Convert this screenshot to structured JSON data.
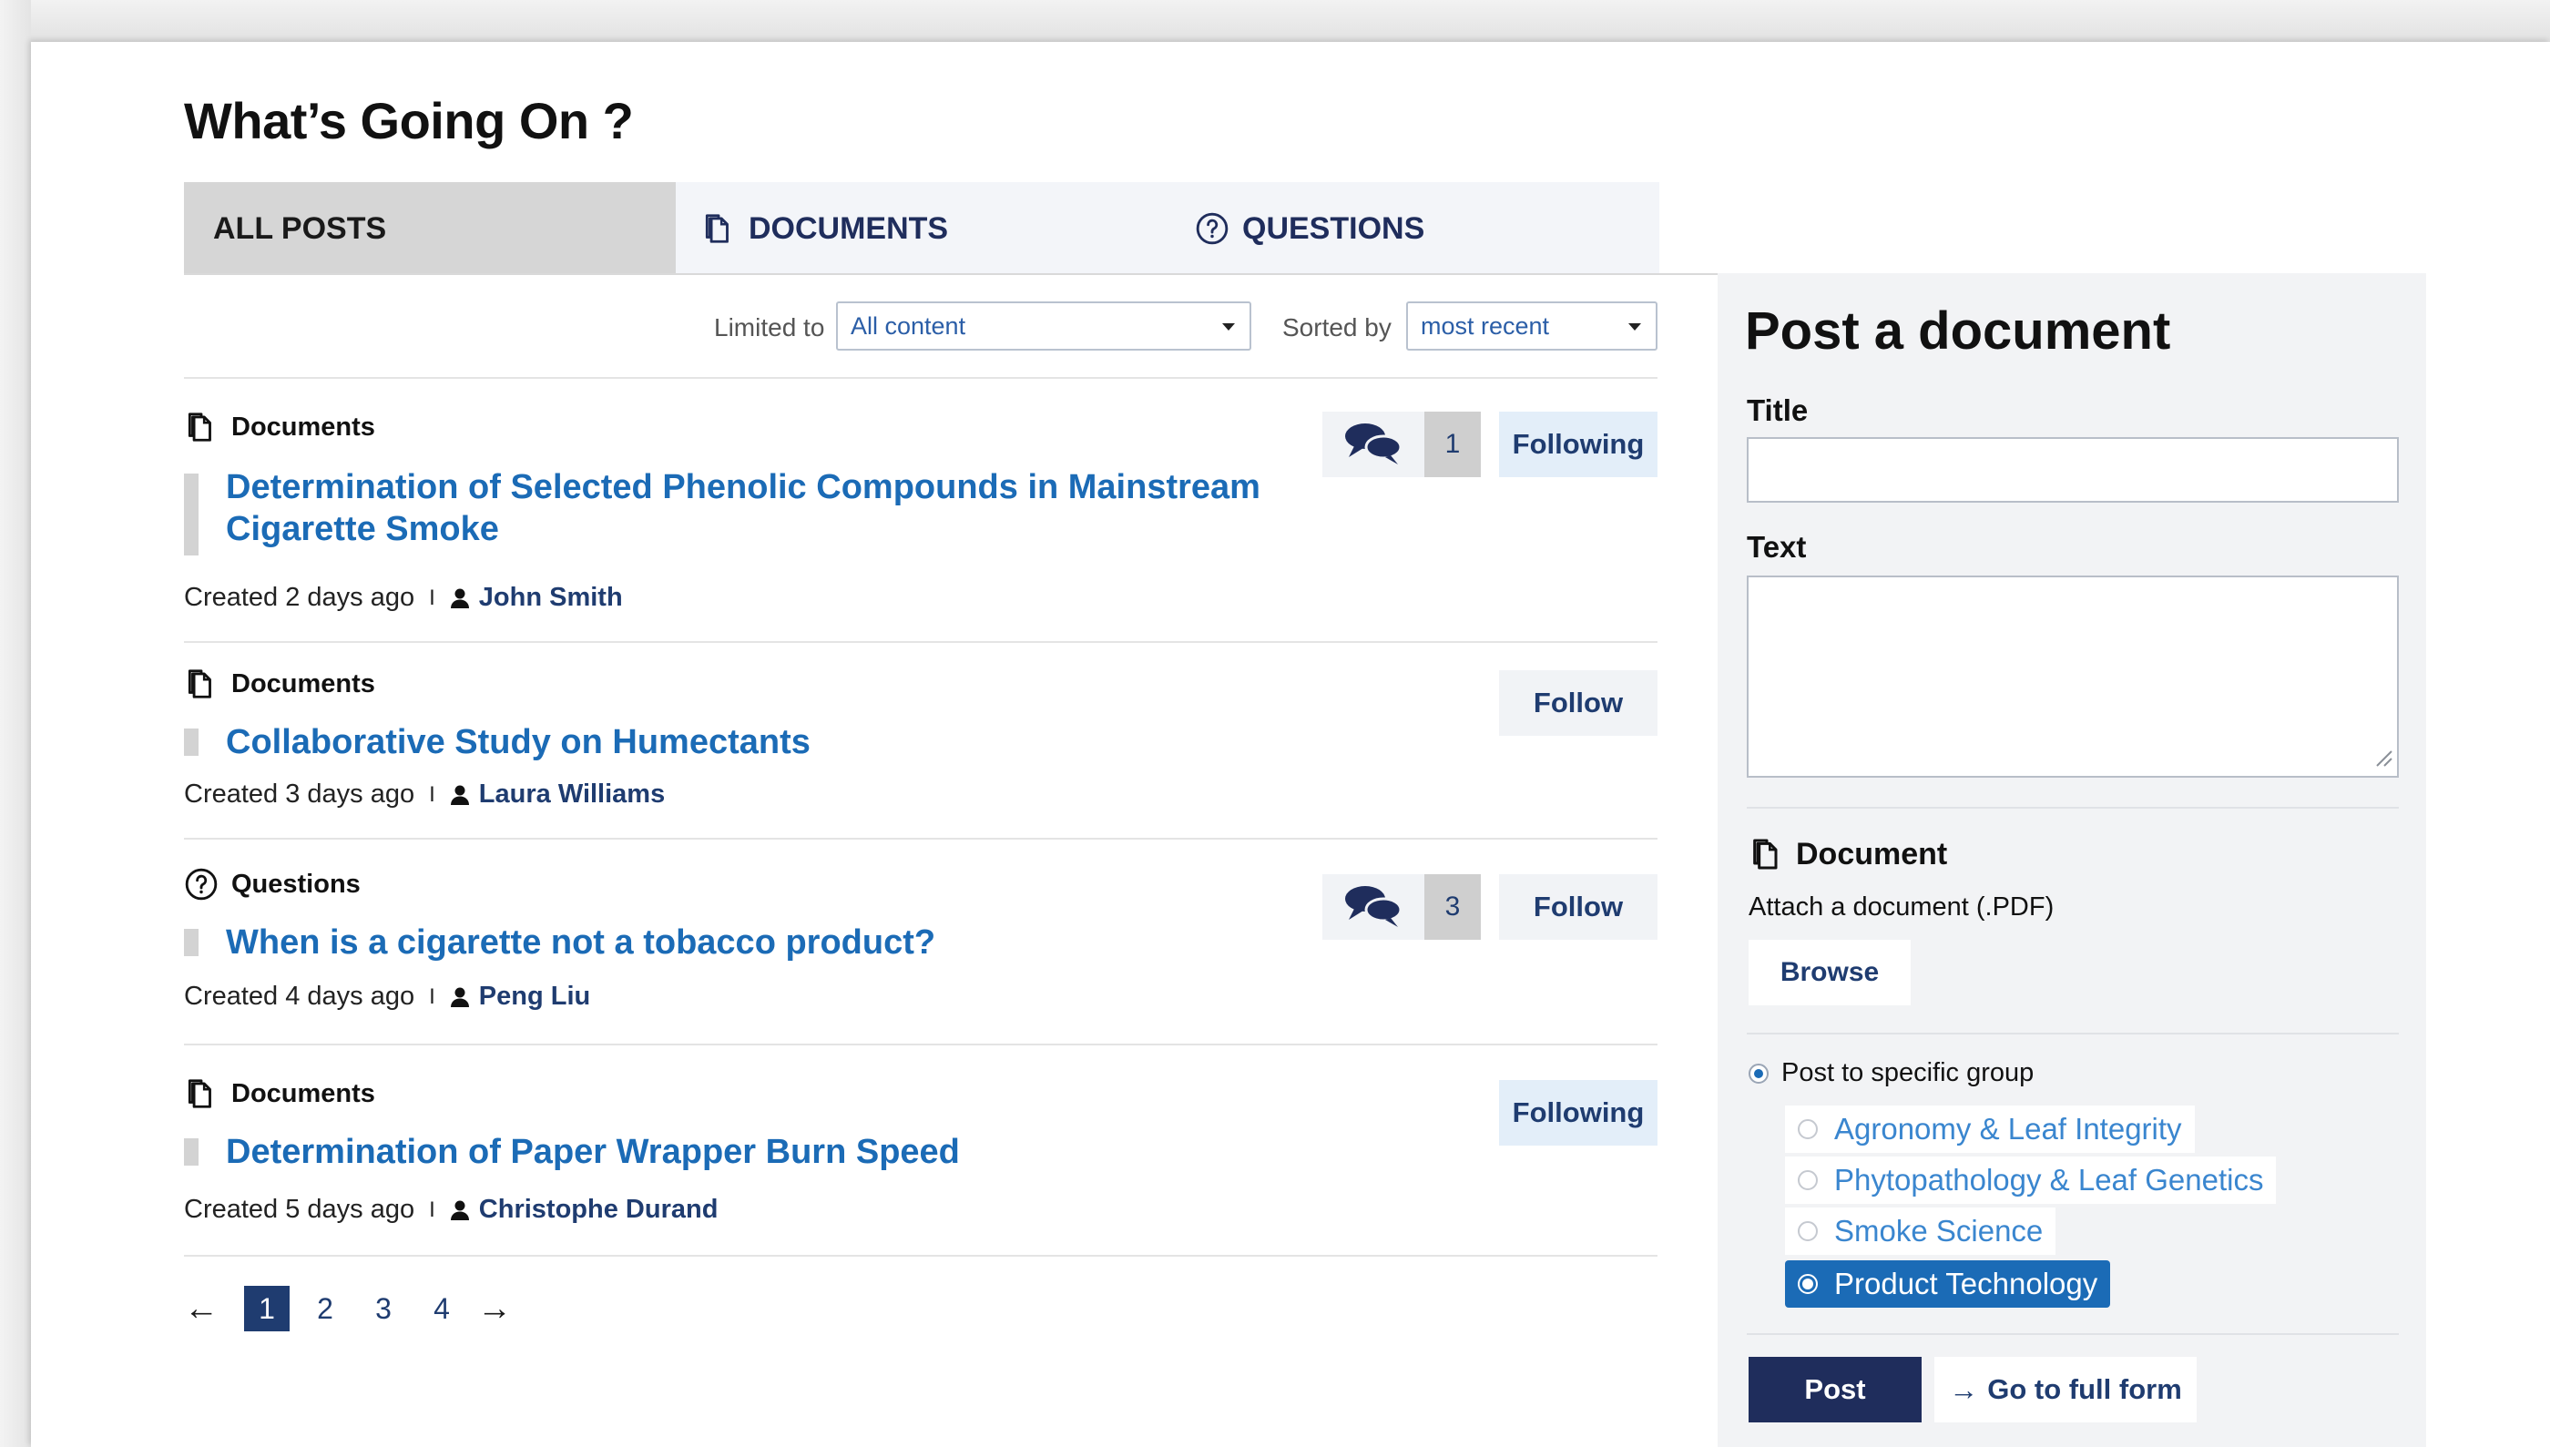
{
  "page": {
    "title": "What’s Going On ?"
  },
  "tabs": [
    {
      "label": "ALL POSTS",
      "icon": "none"
    },
    {
      "label": "DOCUMENTS",
      "icon": "document-icon"
    },
    {
      "label": "QUESTIONS",
      "icon": "question-icon"
    }
  ],
  "filters": {
    "limited_label": "Limited to",
    "limited_value": "All content",
    "sorted_label": "Sorted by",
    "sorted_value": "most recent"
  },
  "posts": [
    {
      "type": "Documents",
      "title_line1": "Determination of Selected Phenolic Compounds in Mainstream",
      "title_line2": "Cigarette Smoke",
      "created": "Created 2 days ago",
      "divider": "I",
      "author": "John Smith",
      "comment_count": "1",
      "follow_label": "Following"
    },
    {
      "type": "Documents",
      "title": "Collaborative Study on Humectants",
      "created": "Created 3 days ago",
      "divider": "I",
      "author": "Laura Williams",
      "follow_label": "Follow"
    },
    {
      "type": "Questions",
      "title": "When is a cigarette not a tobacco product?",
      "created": "Created 4 days ago",
      "divider": "I",
      "author": "Peng Liu",
      "comment_count": "3",
      "follow_label": "Follow"
    },
    {
      "type": "Documents",
      "title": "Determination of Paper Wrapper Burn Speed",
      "created": "Created 5 days ago",
      "divider": "I",
      "author": "Christophe Durand",
      "follow_label": "Following"
    }
  ],
  "pagination": {
    "prev": "←",
    "pages": [
      "1",
      "2",
      "3",
      "4"
    ],
    "current": "1",
    "next": "→"
  },
  "sidebar": {
    "title": "Post a document",
    "title_label": "Title",
    "text_label": "Text",
    "document_label": "Document",
    "attach_text": "Attach a document (.PDF)",
    "browse_label": "Browse",
    "post_to_group_label": "Post to specific group",
    "groups": [
      "Agronomy & Leaf Integrity",
      "Phytopathology & Leaf Genetics",
      "Smoke Science",
      "Product Technology"
    ],
    "selected_group": "Product Technology",
    "post_label": "Post",
    "full_form_label": "Go to full form",
    "full_form_arrow": "→"
  },
  "colors": {
    "navy": "#1f2d5c",
    "link_blue": "#1b6bb6",
    "following_bg": "#e3eef9",
    "sidebar_bg": "#f2f3f5",
    "active_tab_bg": "#d6d6d6"
  }
}
